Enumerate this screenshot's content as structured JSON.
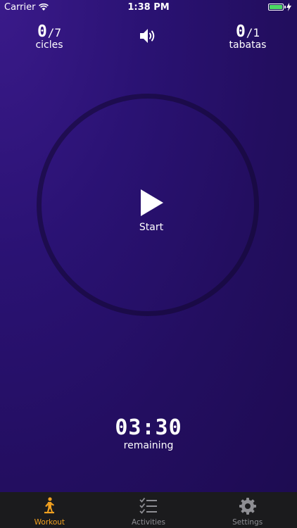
{
  "status_bar": {
    "carrier": "Carrier",
    "time": "1:38 PM"
  },
  "counters": {
    "cycles": {
      "value": "0",
      "total": "/7",
      "label": "cicles"
    },
    "tabatas": {
      "value": "0",
      "total": "/1",
      "label": "tabatas"
    }
  },
  "sound_icon": "speaker-icon",
  "start": {
    "label": "Start"
  },
  "timer": {
    "time": "03:30",
    "label": "remaining"
  },
  "tabs": [
    {
      "label": "Workout",
      "icon": "workout-figure-icon",
      "active": true
    },
    {
      "label": "Activities",
      "icon": "checklist-icon",
      "active": false
    },
    {
      "label": "Settings",
      "icon": "gear-icon",
      "active": false
    }
  ],
  "colors": {
    "accent": "#f0a020",
    "background": "#240f62",
    "tabbar": "#1b1b1d"
  }
}
